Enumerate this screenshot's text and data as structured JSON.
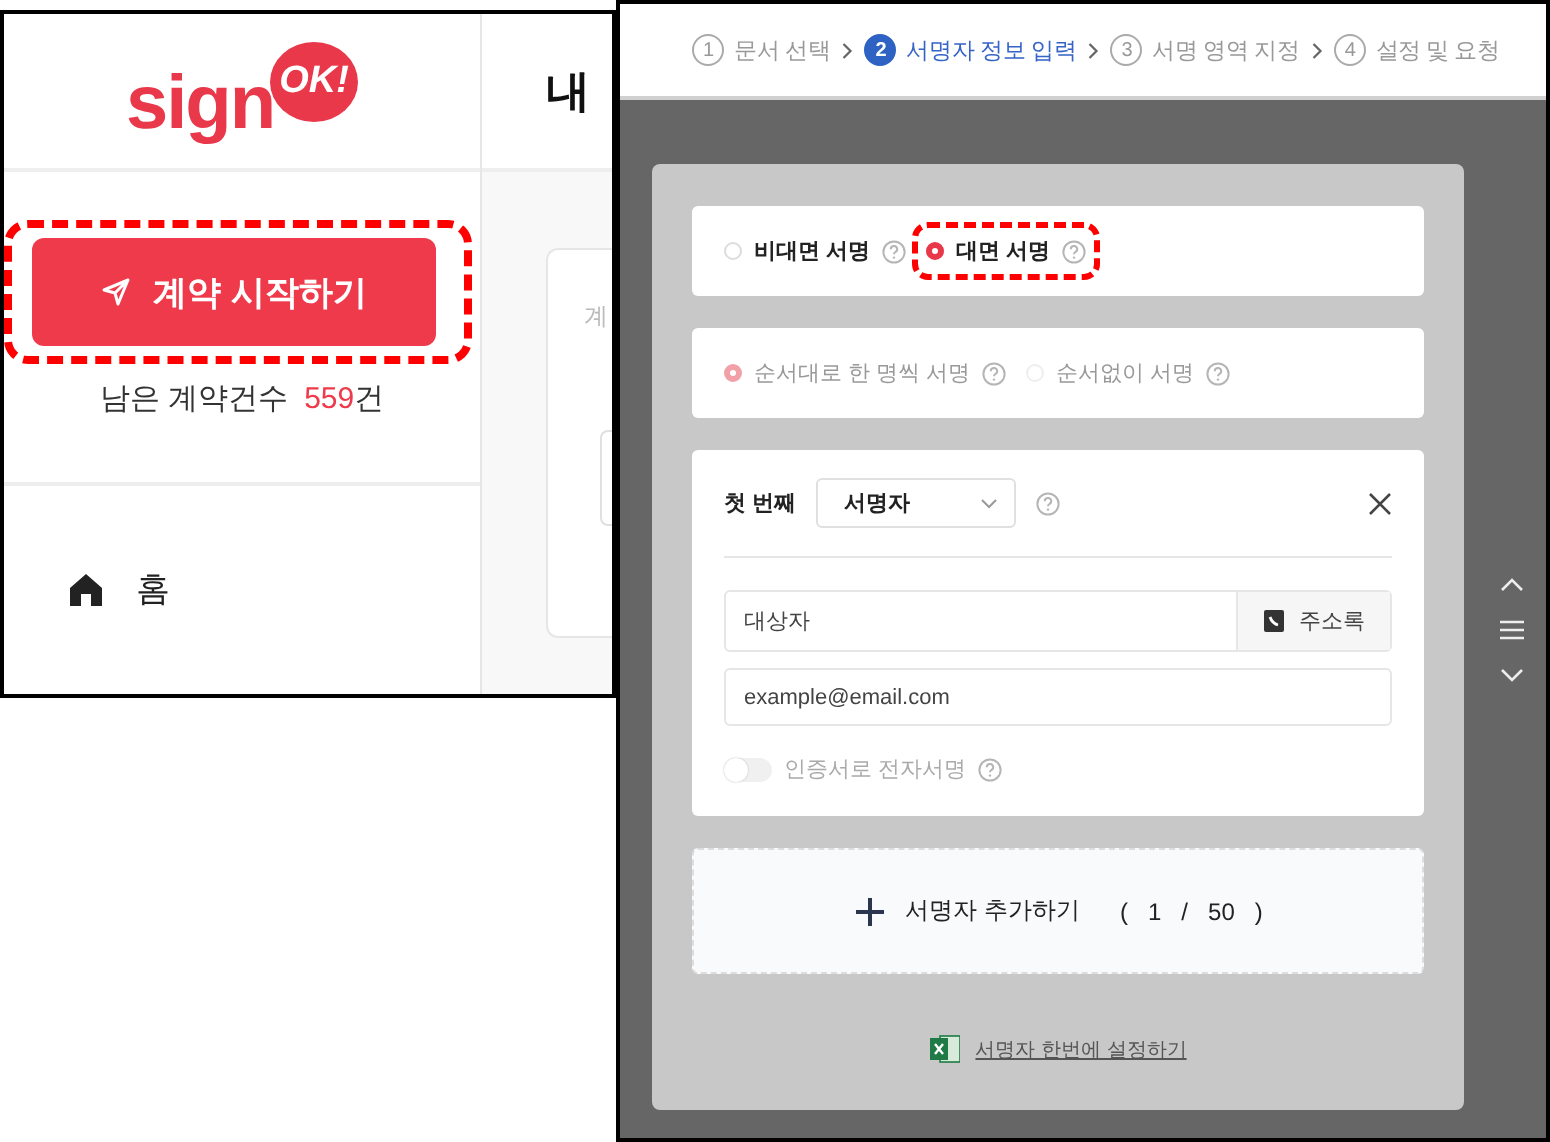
{
  "left_window": {
    "logo": {
      "text": "sign",
      "badge": "OK!"
    },
    "start_button": {
      "label": "계약 시작하기",
      "highlighted": true
    },
    "remaining": {
      "label": "남은 계약건수",
      "count": "559",
      "unit": "건"
    },
    "nav": [
      {
        "label": "홈"
      }
    ],
    "page_title": "내",
    "card_label": "계"
  },
  "right_window": {
    "steps": [
      {
        "number": "1",
        "label": "문서 선택",
        "selected": false
      },
      {
        "number": "2",
        "label": "서명자 정보 입력",
        "selected": true
      },
      {
        "number": "3",
        "label": "서명 영역 지정",
        "selected": false
      },
      {
        "number": "4",
        "label": "설정 및 요청",
        "selected": false
      }
    ],
    "sign_mode": {
      "disabled": false,
      "options": [
        {
          "label": "비대면 서명",
          "selected": false,
          "highlighted": false
        },
        {
          "label": "대면 서명",
          "selected": true,
          "highlighted": true
        }
      ]
    },
    "order_mode": {
      "disabled": true,
      "options": [
        {
          "label": "순서대로 한 명씩 서명",
          "selected": true,
          "highlighted": false
        },
        {
          "label": "순서없이 서명",
          "selected": false,
          "highlighted": false
        }
      ]
    },
    "signer": {
      "order": "첫 번째",
      "role": "서명자",
      "name_placeholder": "대상자",
      "address_button": "주소록",
      "email_placeholder": "example@email.com",
      "certificate": {
        "label": "인증서로 전자서명",
        "on": false,
        "disabled": true
      }
    },
    "add_signer": {
      "label": "서명자 추가하기",
      "open": "(",
      "count": "1",
      "separator": "/",
      "max": "50",
      "close": ")"
    },
    "bulk_link": "서명자 한번에 설정하기"
  }
}
